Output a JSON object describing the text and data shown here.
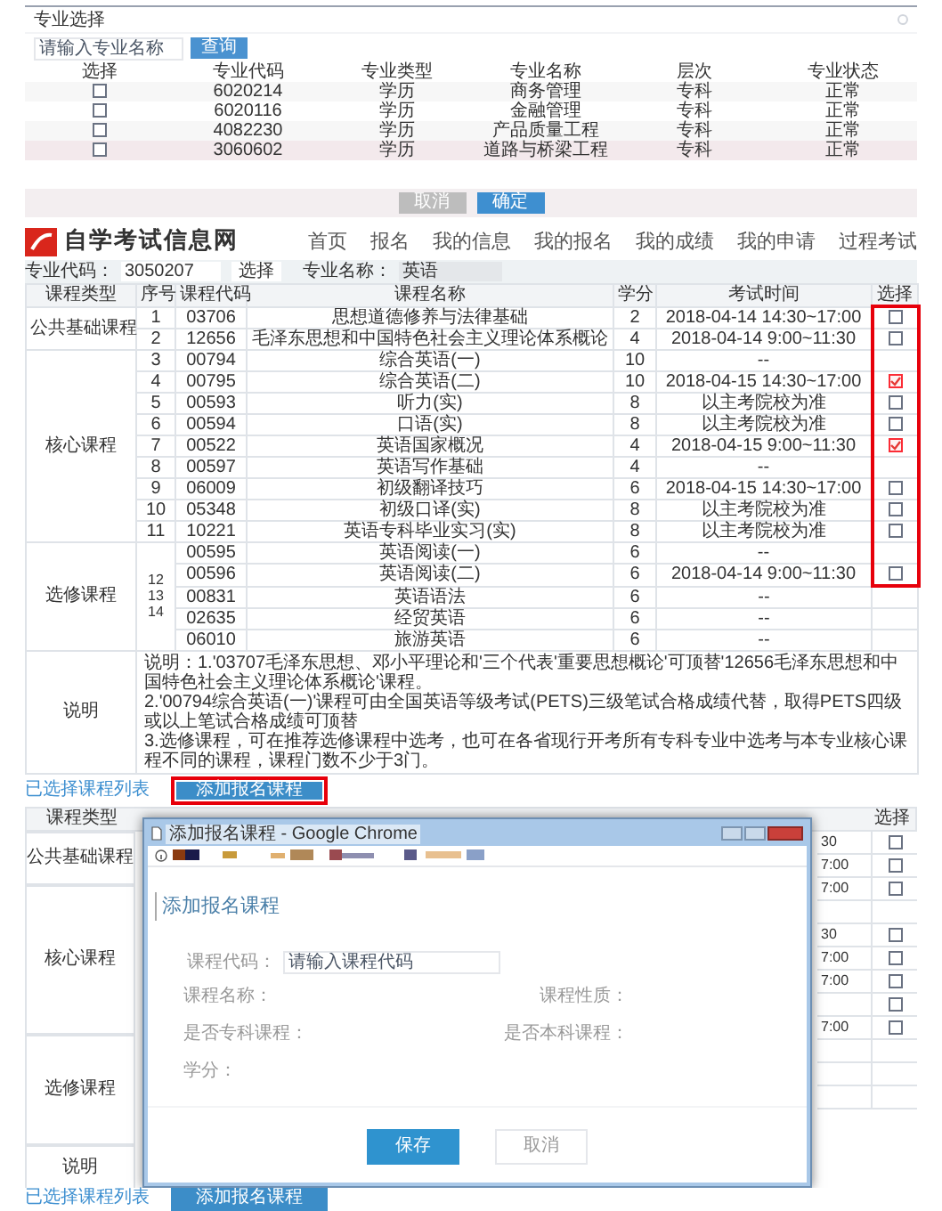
{
  "major_dialog": {
    "title": "专业选择",
    "search": {
      "placeholder": "请输入专业名称"
    },
    "search_button": "查询",
    "columns": [
      "选择",
      "专业代码",
      "专业类型",
      "专业名称",
      "层次",
      "专业状态"
    ],
    "rows": [
      {
        "checked": false,
        "highlighted": false,
        "code": "6020214",
        "type": "学历",
        "name": "商务管理",
        "level": "专科",
        "status": "正常"
      },
      {
        "checked": false,
        "highlighted": false,
        "code": "6020116",
        "type": "学历",
        "name": "金融管理",
        "level": "专科",
        "status": "正常"
      },
      {
        "checked": false,
        "highlighted": false,
        "code": "4082230",
        "type": "学历",
        "name": "产品质量工程",
        "level": "专科",
        "status": "正常"
      },
      {
        "checked": false,
        "highlighted": true,
        "code": "3060602",
        "type": "学历",
        "name": "道路与桥梁工程",
        "level": "专科",
        "status": "正常"
      }
    ],
    "buttons": [
      {
        "label": "取消",
        "kind": "secondary"
      },
      {
        "label": "确定",
        "kind": "primary"
      }
    ]
  },
  "site": {
    "logo_text": "自学考试信息网",
    "nav": [
      "首页",
      "报名",
      "我的信息",
      "我的报名",
      "我的成绩",
      "我的申请",
      "过程考试"
    ]
  },
  "major_form": {
    "code_label": "专业代码：",
    "code_value": "3050207",
    "select_button": "选择",
    "name_label": "专业名称：",
    "name_value": "英语"
  },
  "course_table": {
    "columns": [
      "课程类型",
      "序号",
      "课程代码",
      "课程名称",
      "学分",
      "考试时间",
      "选择"
    ],
    "groups": [
      {
        "type": "公共基础课程",
        "rows": [
          {
            "seq": "1",
            "code": "03706",
            "name": "思想道德修养与法律基础",
            "credit": "2",
            "time": "2018-04-14 14:30~17:00",
            "checked": false,
            "marked": true
          },
          {
            "seq": "2",
            "code": "12656",
            "name": "毛泽东思想和中国特色社会主义理论体系概论",
            "credit": "4",
            "time": "2018-04-14 9:00~11:30",
            "checked": false,
            "marked": true
          }
        ]
      },
      {
        "type": "核心课程",
        "rows": [
          {
            "seq": "3",
            "code": "00794",
            "name": "综合英语(一)",
            "credit": "10",
            "time": "--",
            "marked": true
          },
          {
            "seq": "4",
            "code": "00795",
            "name": "综合英语(二)",
            "credit": "10",
            "time": "2018-04-15 14:30~17:00",
            "checked": true,
            "marked": true
          },
          {
            "seq": "5",
            "code": "00593",
            "name": "听力(实)",
            "credit": "8",
            "time": "以主考院校为准",
            "checked": false,
            "marked": true
          },
          {
            "seq": "6",
            "code": "00594",
            "name": "口语(实)",
            "credit": "8",
            "time": "以主考院校为准",
            "checked": false,
            "marked": true
          },
          {
            "seq": "7",
            "code": "00522",
            "name": "英语国家概况",
            "credit": "4",
            "time": "2018-04-15 9:00~11:30",
            "checked": true,
            "marked": true
          },
          {
            "seq": "8",
            "code": "00597",
            "name": "英语写作基础",
            "credit": "4",
            "time": "--",
            "marked": true
          },
          {
            "seq": "9",
            "code": "06009",
            "name": "初级翻译技巧",
            "credit": "6",
            "time": "2018-04-15 14:30~17:00",
            "checked": false,
            "marked": true
          },
          {
            "seq": "10",
            "code": "05348",
            "name": "初级口译(实)",
            "credit": "8",
            "time": "以主考院校为准",
            "checked": false,
            "marked": true
          },
          {
            "seq": "11",
            "code": "10221",
            "name": "英语专科毕业实习(实)",
            "credit": "8",
            "time": "以主考院校为准",
            "checked": false,
            "marked": true
          }
        ]
      },
      {
        "type": "选修课程",
        "merged_seq": [
          "12",
          "13",
          "14"
        ],
        "rows": [
          {
            "code": "00595",
            "name": "英语阅读(一)",
            "credit": "6",
            "time": "--",
            "marked": true
          },
          {
            "code": "00596",
            "name": "英语阅读(二)",
            "credit": "6",
            "time": "2018-04-14 9:00~11:30",
            "checked": false,
            "marked": true
          },
          {
            "code": "00831",
            "name": "英语语法",
            "credit": "6",
            "time": "--",
            "marked": false
          },
          {
            "code": "02635",
            "name": "经贸英语",
            "credit": "6",
            "time": "--",
            "marked": false
          },
          {
            "code": "06010",
            "name": "旅游英语",
            "credit": "6",
            "time": "--",
            "marked": false
          }
        ]
      }
    ],
    "note_label": "说明",
    "note_lines": [
      "说明：1.'03707毛泽东思想、邓小平理论和'三个代表'重要思想概论'可顶替'12656毛泽东思想和中国特色社会主义理论体系概论'课程。",
      "2.'00794综合英语(一)'课程可由全国英语等级考试(PETS)三级笔试合格成绩代替，取得PETS四级或以上笔试合格成绩可顶替",
      "3.选修课程，可在推荐选修课程中选考，也可在各省现行开考所有专科专业中选考与本专业核心课程不同的课程，课程门数不少于3门。"
    ]
  },
  "selected_bar": {
    "label": "已选择课程列表",
    "button": "添加报名课程",
    "highlighted": true
  },
  "background_table": {
    "columns": [
      "课程类型",
      "选择"
    ],
    "groups": [
      "公共基础课程",
      "核心课程",
      "选修课程",
      "说明"
    ],
    "right_rows": [
      {
        "fragment": "30",
        "checked": false
      },
      {
        "fragment": "7:00",
        "checked": false
      },
      {
        "fragment": "7:00",
        "checked": false
      },
      {},
      {
        "fragment": "30",
        "checked": false
      },
      {
        "fragment": "7:00",
        "checked": false
      },
      {
        "fragment": "7:00",
        "checked": false
      },
      {
        "checked": false
      },
      {
        "fragment": "7:00",
        "checked": false
      },
      {},
      {},
      {}
    ]
  },
  "chrome_dialog": {
    "title": "添加报名课程 - Google Chrome",
    "heading": "添加报名课程",
    "code_field": {
      "label": "课程代码：",
      "placeholder": "请输入课程代码"
    },
    "info_labels": [
      "课程名称：",
      "课程性质：",
      "是否专科课程：",
      "是否本科课程：",
      "学分："
    ],
    "buttons": [
      {
        "label": "保存",
        "kind": "primary"
      },
      {
        "label": "取消",
        "kind": "secondary"
      }
    ]
  },
  "footer_bar": {
    "label": "已选择课程列表",
    "button": "添加报名课程",
    "highlighted": false
  }
}
